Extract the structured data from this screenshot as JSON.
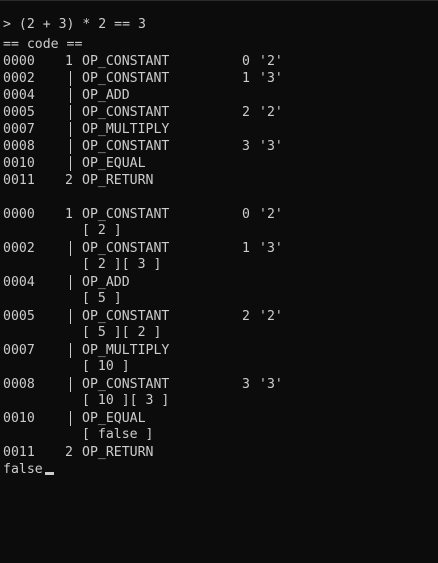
{
  "prompt_line": "> (2 + 3) * 2 == 3",
  "code_header": "== code ==",
  "code": [
    {
      "offset": "0000",
      "line": "1",
      "op": "OP_CONSTANT",
      "index": "0",
      "value": "'2'"
    },
    {
      "offset": "0002",
      "line": "|",
      "op": "OP_CONSTANT",
      "index": "1",
      "value": "'3'"
    },
    {
      "offset": "0004",
      "line": "|",
      "op": "OP_ADD",
      "index": "",
      "value": ""
    },
    {
      "offset": "0005",
      "line": "|",
      "op": "OP_CONSTANT",
      "index": "2",
      "value": "'2'"
    },
    {
      "offset": "0007",
      "line": "|",
      "op": "OP_MULTIPLY",
      "index": "",
      "value": ""
    },
    {
      "offset": "0008",
      "line": "|",
      "op": "OP_CONSTANT",
      "index": "3",
      "value": "'3'"
    },
    {
      "offset": "0010",
      "line": "|",
      "op": "OP_EQUAL",
      "index": "",
      "value": ""
    },
    {
      "offset": "0011",
      "line": "2",
      "op": "OP_RETURN",
      "index": "",
      "value": ""
    }
  ],
  "trace": [
    {
      "offset": "0000",
      "line": "1",
      "op": "OP_CONSTANT",
      "index": "0",
      "value": "'2'",
      "stack": "[ 2 ]"
    },
    {
      "offset": "0002",
      "line": "|",
      "op": "OP_CONSTANT",
      "index": "1",
      "value": "'3'",
      "stack": "[ 2 ][ 3 ]"
    },
    {
      "offset": "0004",
      "line": "|",
      "op": "OP_ADD",
      "index": "",
      "value": "",
      "stack": "[ 5 ]"
    },
    {
      "offset": "0005",
      "line": "|",
      "op": "OP_CONSTANT",
      "index": "2",
      "value": "'2'",
      "stack": "[ 5 ][ 2 ]"
    },
    {
      "offset": "0007",
      "line": "|",
      "op": "OP_MULTIPLY",
      "index": "",
      "value": "",
      "stack": "[ 10 ]"
    },
    {
      "offset": "0008",
      "line": "|",
      "op": "OP_CONSTANT",
      "index": "3",
      "value": "'3'",
      "stack": "[ 10 ][ 3 ]"
    },
    {
      "offset": "0010",
      "line": "|",
      "op": "OP_EQUAL",
      "index": "",
      "value": "",
      "stack": "[ false ]"
    },
    {
      "offset": "0011",
      "line": "2",
      "op": "OP_RETURN",
      "index": "",
      "value": "",
      "stack": ""
    }
  ],
  "result": "false",
  "colors": {
    "background": "#0c0c0c",
    "text": "#cccccc"
  }
}
